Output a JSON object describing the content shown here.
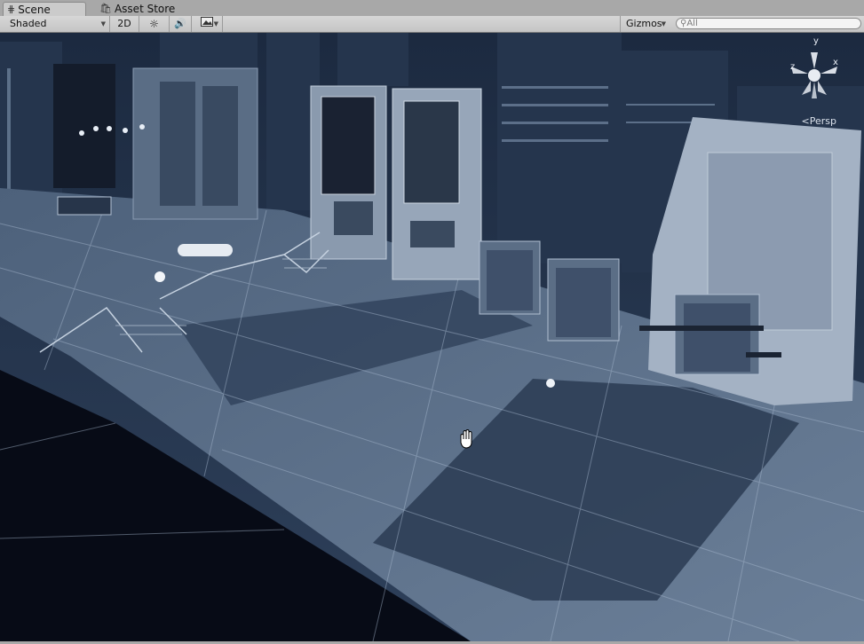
{
  "tabs": [
    {
      "label": "Scene",
      "icon": "grid-icon",
      "active": true
    },
    {
      "label": "Asset Store",
      "icon": "store-icon",
      "active": false
    }
  ],
  "toolbar": {
    "shading_mode": "Shaded",
    "mode_2d": "2D",
    "gizmos_label": "Gizmos",
    "search_placeholder": "All"
  },
  "gizmo": {
    "projection": "Persp",
    "axes": {
      "x": "x",
      "y": "y",
      "z": "z"
    }
  },
  "colors": {
    "toolbar_bg": "#c8c8c8",
    "viewport_tint": "#3f5570",
    "sky": "#0a1020"
  }
}
